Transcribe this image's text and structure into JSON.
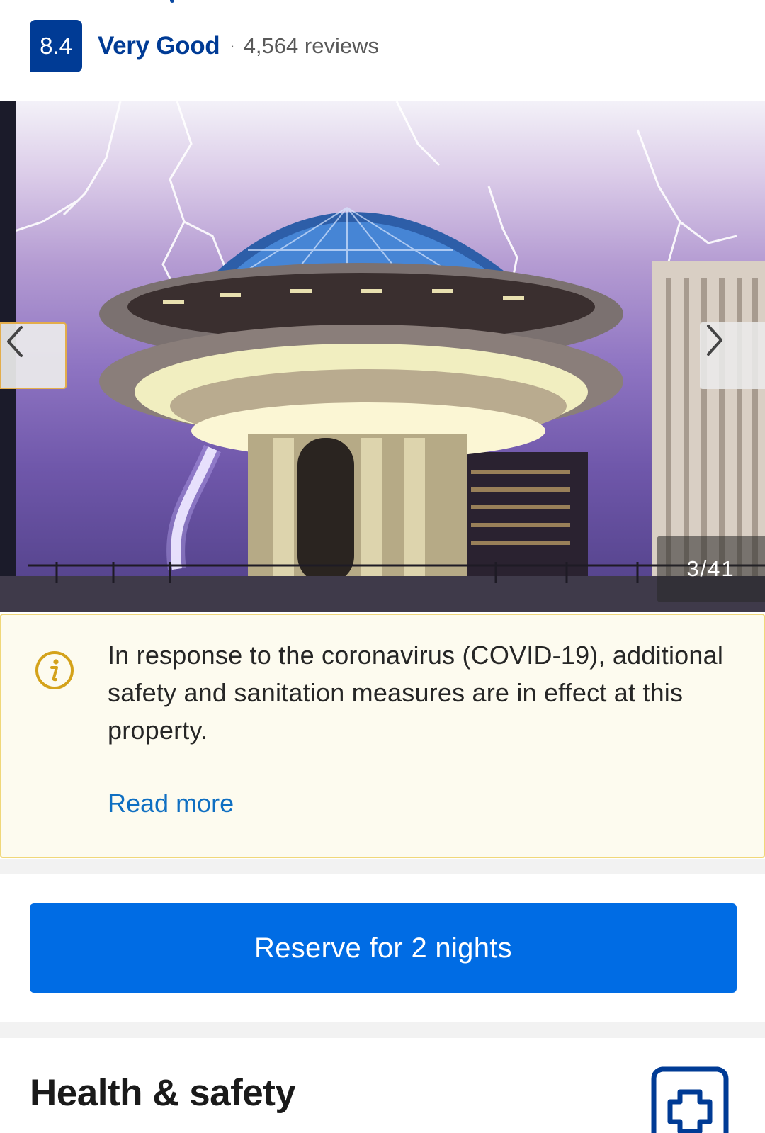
{
  "rating": {
    "score": "8.4",
    "label": "Very Good",
    "separator": "·",
    "reviews": "4,564 reviews"
  },
  "gallery": {
    "counter": "3/41",
    "prev_icon": "chevron-left-icon",
    "next_icon": "chevron-right-icon"
  },
  "notice": {
    "icon": "info-icon",
    "text": "In response to the coronavirus (COVID-19), additional safety and sanitation measures are in effect at this property.",
    "link": "Read more"
  },
  "reserve": {
    "label": "Reserve for 2 nights"
  },
  "health": {
    "title": "Health & safety",
    "icon": "medical-shield-icon"
  },
  "colors": {
    "brand_dark": "#003b95",
    "primary": "#006ce4",
    "link": "#0f6fc2",
    "notice_bg": "#fdfbef",
    "notice_border": "#f0d779",
    "info_icon": "#d4a21a"
  }
}
